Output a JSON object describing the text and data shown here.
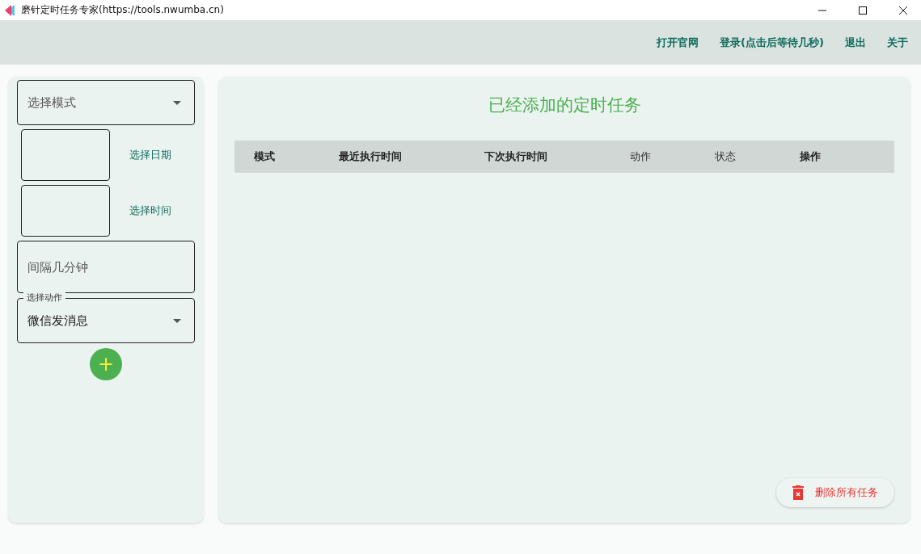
{
  "window": {
    "title": "磨针定时任务专家(https://tools.nwumba.cn)"
  },
  "toolbar": {
    "actions": [
      "打开官网",
      "登录(点击后等待几秒)",
      "退出",
      "关于"
    ]
  },
  "form": {
    "mode_select": {
      "placeholder": "选择模式"
    },
    "date_picker": {
      "label": "选择日期"
    },
    "time_picker": {
      "label": "选择时间"
    },
    "interval": {
      "placeholder": "间隔几分钟"
    },
    "action_select": {
      "label": "选择动作",
      "value": "微信发消息"
    },
    "add_button": {
      "label": "+"
    }
  },
  "tasks": {
    "title": "已经添加的定时任务",
    "columns": [
      {
        "label": "模式",
        "bold": true
      },
      {
        "label": "最近执行时间",
        "bold": true
      },
      {
        "label": "下次执行时间",
        "bold": true
      },
      {
        "label": "动作",
        "bold": false
      },
      {
        "label": "状态",
        "bold": false
      },
      {
        "label": "操作",
        "bold": true
      }
    ]
  },
  "delete_all_button": {
    "label": "删除所有任务"
  }
}
